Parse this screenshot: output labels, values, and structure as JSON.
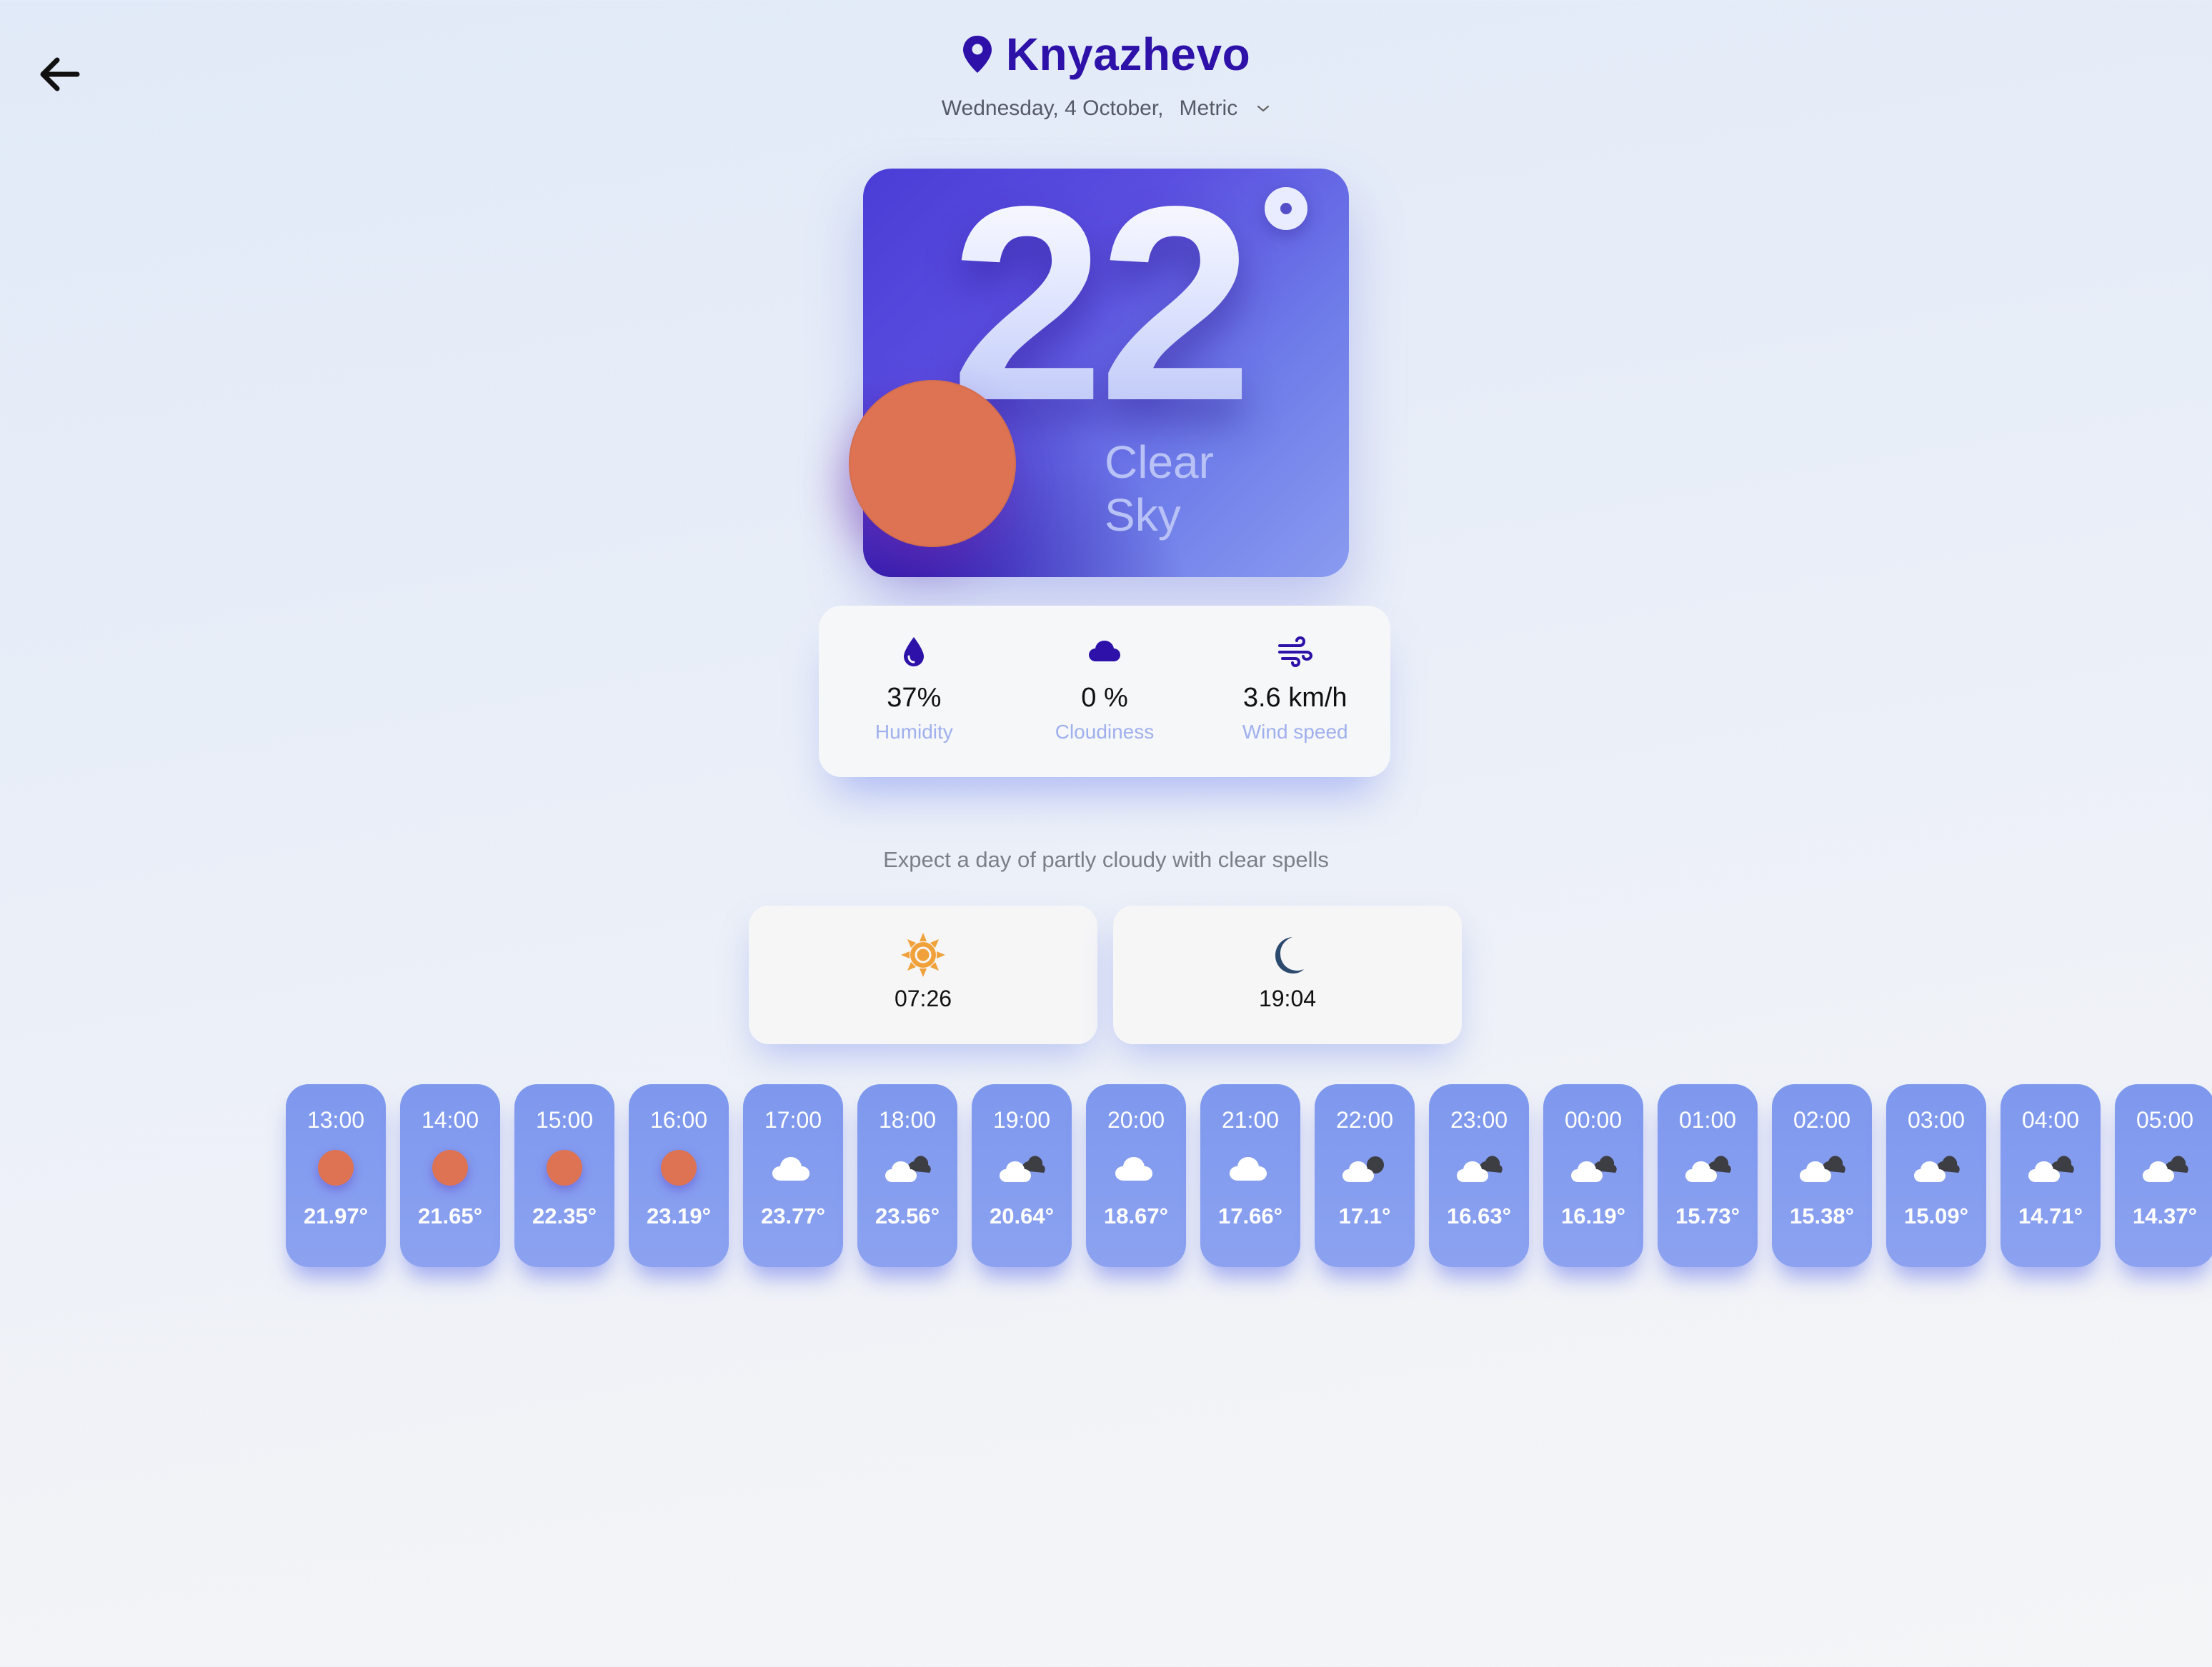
{
  "header": {
    "city": "Knyazhevo",
    "date": "Wednesday, 4 October,",
    "units": "Metric"
  },
  "current": {
    "temperature": "22",
    "condition_line1": "Clear",
    "condition_line2": "Sky"
  },
  "stats": [
    {
      "icon": "droplet-icon",
      "value": "37%",
      "label": "Humidity"
    },
    {
      "icon": "cloud-icon",
      "value": "0 %",
      "label": "Cloudiness"
    },
    {
      "icon": "wind-icon",
      "value": "3.6 km/h",
      "label": "Wind speed"
    }
  ],
  "summary": "Expect a day of partly cloudy with clear spells",
  "sun_times": {
    "sunrise": "07:26",
    "sunset": "19:04"
  },
  "hourly": [
    {
      "time": "13:00",
      "icon": "sun-icon",
      "temp": "21.97°"
    },
    {
      "time": "14:00",
      "icon": "sun-icon",
      "temp": "21.65°"
    },
    {
      "time": "15:00",
      "icon": "sun-icon",
      "temp": "22.35°"
    },
    {
      "time": "16:00",
      "icon": "sun-icon",
      "temp": "23.19°"
    },
    {
      "time": "17:00",
      "icon": "cloud-icon",
      "temp": "23.77°"
    },
    {
      "time": "18:00",
      "icon": "broken-clouds-icon",
      "temp": "23.56°"
    },
    {
      "time": "19:00",
      "icon": "broken-clouds-icon",
      "temp": "20.64°"
    },
    {
      "time": "20:00",
      "icon": "cloud-icon",
      "temp": "18.67°"
    },
    {
      "time": "21:00",
      "icon": "cloud-icon",
      "temp": "17.66°"
    },
    {
      "time": "22:00",
      "icon": "cloud-night-icon",
      "temp": "17.1°"
    },
    {
      "time": "23:00",
      "icon": "broken-clouds-icon",
      "temp": "16.63°"
    },
    {
      "time": "00:00",
      "icon": "broken-clouds-icon",
      "temp": "16.19°"
    },
    {
      "time": "01:00",
      "icon": "broken-clouds-icon",
      "temp": "15.73°"
    },
    {
      "time": "02:00",
      "icon": "broken-clouds-icon",
      "temp": "15.38°"
    },
    {
      "time": "03:00",
      "icon": "broken-clouds-icon",
      "temp": "15.09°"
    },
    {
      "time": "04:00",
      "icon": "broken-clouds-icon",
      "temp": "14.71°"
    },
    {
      "time": "05:00",
      "icon": "broken-clouds-icon",
      "temp": "14.37°"
    }
  ],
  "colors": {
    "accent": "#2d11a8",
    "sun": "#dd7352",
    "hour_card": "#8299ee",
    "stat_label": "#9fb0ee"
  }
}
